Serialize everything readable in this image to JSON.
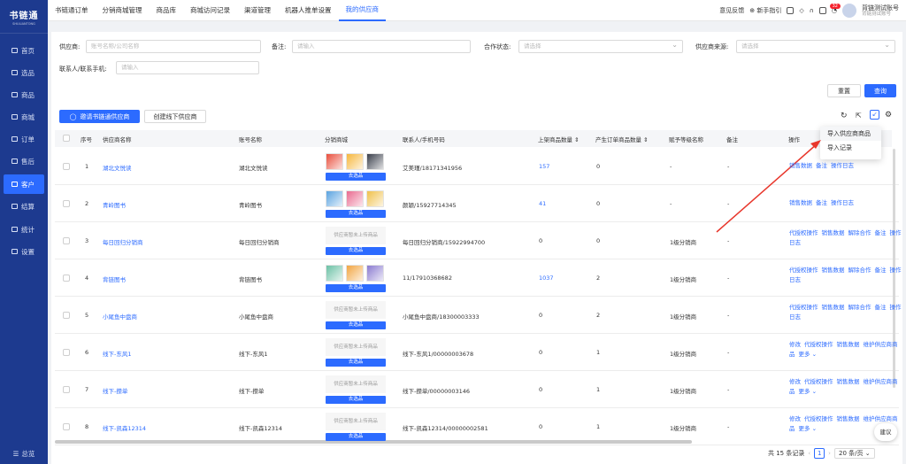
{
  "app": {
    "logo": "书链通",
    "logo_sub": "SHULIANTONG"
  },
  "sidebar": {
    "items": [
      {
        "label": "首页",
        "icon": "monitor-icon"
      },
      {
        "label": "选品",
        "icon": "grid-icon"
      },
      {
        "label": "商品",
        "icon": "box-icon"
      },
      {
        "label": "商城",
        "icon": "shop-icon"
      },
      {
        "label": "订单",
        "icon": "order-icon"
      },
      {
        "label": "售后",
        "icon": "headset-icon"
      },
      {
        "label": "客户",
        "icon": "users-icon",
        "active": true
      },
      {
        "label": "结算",
        "icon": "coin-icon"
      },
      {
        "label": "统计",
        "icon": "chart-icon"
      },
      {
        "label": "设置",
        "icon": "settings-icon"
      }
    ],
    "bottom": "总览"
  },
  "topbar": {
    "tabs": [
      "书链通订单",
      "分销商城管理",
      "商品库",
      "商城访问记录",
      "渠道管理",
      "机器人推单设置",
      "我的供应商"
    ],
    "active_tab": 6,
    "feedback": "意见反馈",
    "guide": "新手指引",
    "badge": "32",
    "user_name": "背链测试账号",
    "user_sub": "背链测试账号"
  },
  "filters": {
    "supplier_label": "供应商:",
    "supplier_ph": "账号名称/公司名称",
    "remark_label": "备注:",
    "remark_ph": "请输入",
    "status_label": "合作状态:",
    "status_ph": "请选择",
    "source_label": "供应商来源:",
    "source_ph": "请选择",
    "contact_label": "联系人/联系手机:",
    "contact_ph": "请输入",
    "reset": "重置",
    "query": "查询"
  },
  "actions": {
    "invite": "邀请书链通供应商",
    "create": "创建线下供应商"
  },
  "dropdown": {
    "items": [
      "导入供应商商品",
      "导入记录"
    ]
  },
  "table": {
    "headers": [
      "序号",
      "供应商名称",
      "账号名称",
      "分销商城",
      "联系人/手机号码",
      "上架商品数量",
      "产生订单商品数量",
      "赋予等级名称",
      "备注",
      "操作"
    ],
    "empty_mall": "供应商暂未上传商品",
    "go_select": "去选品",
    "rows": [
      {
        "no": "1",
        "name": "湖北文悦读",
        "account": "湖北文悦读",
        "mall": "thumbs",
        "contact": "艾美瑾/18171341956",
        "listed": "157",
        "listed_link": true,
        "orders": "0",
        "level": "-",
        "remark": "-",
        "ops": [
          "销售数据",
          "备注",
          "操作日志"
        ]
      },
      {
        "no": "2",
        "name": "青岭图书",
        "account": "青岭图书",
        "mall": "thumbs",
        "contact": "颜颖/15927714345",
        "listed": "41",
        "listed_link": true,
        "orders": "0",
        "level": "-",
        "remark": "-",
        "ops": [
          "销售数据",
          "备注",
          "操作日志"
        ]
      },
      {
        "no": "3",
        "name": "每日回归分销商",
        "account": "每日回归分销商",
        "mall": "empty",
        "contact": "每日回归分销商/15922994700",
        "listed": "0",
        "listed_link": false,
        "orders": "0",
        "level": "1级分销商",
        "remark": "-",
        "ops": [
          "代授权操作",
          "销售数据",
          "解除合作",
          "备注",
          "操作日志"
        ]
      },
      {
        "no": "4",
        "name": "背链图书",
        "account": "背链图书",
        "mall": "thumbs",
        "contact": "11/17910368682",
        "listed": "1037",
        "listed_link": true,
        "orders": "2",
        "level": "1级分销商",
        "remark": "-",
        "ops": [
          "代授权操作",
          "销售数据",
          "解除合作",
          "备注",
          "操作日志"
        ]
      },
      {
        "no": "5",
        "name": "小尾鱼中盘商",
        "account": "小尾鱼中盘商",
        "mall": "empty",
        "contact": "小尾鱼中盘商/18300003333",
        "listed": "0",
        "listed_link": false,
        "orders": "2",
        "level": "1级分销商",
        "remark": "-",
        "ops": [
          "代授权操作",
          "销售数据",
          "解除合作",
          "备注",
          "操作日志"
        ]
      },
      {
        "no": "6",
        "name": "线下-东风1",
        "account": "线下-东风1",
        "mall": "empty",
        "contact": "线下-东风1/00000003678",
        "listed": "0",
        "listed_link": false,
        "orders": "1",
        "level": "1级分销商",
        "remark": "-",
        "ops": [
          "修改",
          "代授权操作",
          "销售数据",
          "维护供应商商品",
          "更多 ⌄"
        ]
      },
      {
        "no": "7",
        "name": "线下-攒单",
        "account": "线下-攒单",
        "mall": "empty",
        "contact": "线下-攒单/00000003146",
        "listed": "0",
        "listed_link": false,
        "orders": "1",
        "level": "1级分销商",
        "remark": "-",
        "ops": [
          "修改",
          "代授权操作",
          "销售数据",
          "维护供应商商品",
          "更多 ⌄"
        ]
      },
      {
        "no": "8",
        "name": "线下-凯森12314",
        "account": "线下-凯森12314",
        "mall": "empty",
        "contact": "线下-凯森12314/00000002581",
        "listed": "0",
        "listed_link": false,
        "orders": "1",
        "level": "1级分销商",
        "remark": "-",
        "ops": [
          "修改",
          "代授权操作",
          "销售数据",
          "维护供应商商品",
          "更多 ⌄"
        ]
      }
    ]
  },
  "pager": {
    "total": "共 15 条记录",
    "current": "1",
    "size": "20 条/页"
  },
  "fab": "建议",
  "colors": {
    "primary": "#2c6bff",
    "sidebar": "#1d3a8f",
    "arrow": "#e8362b"
  }
}
